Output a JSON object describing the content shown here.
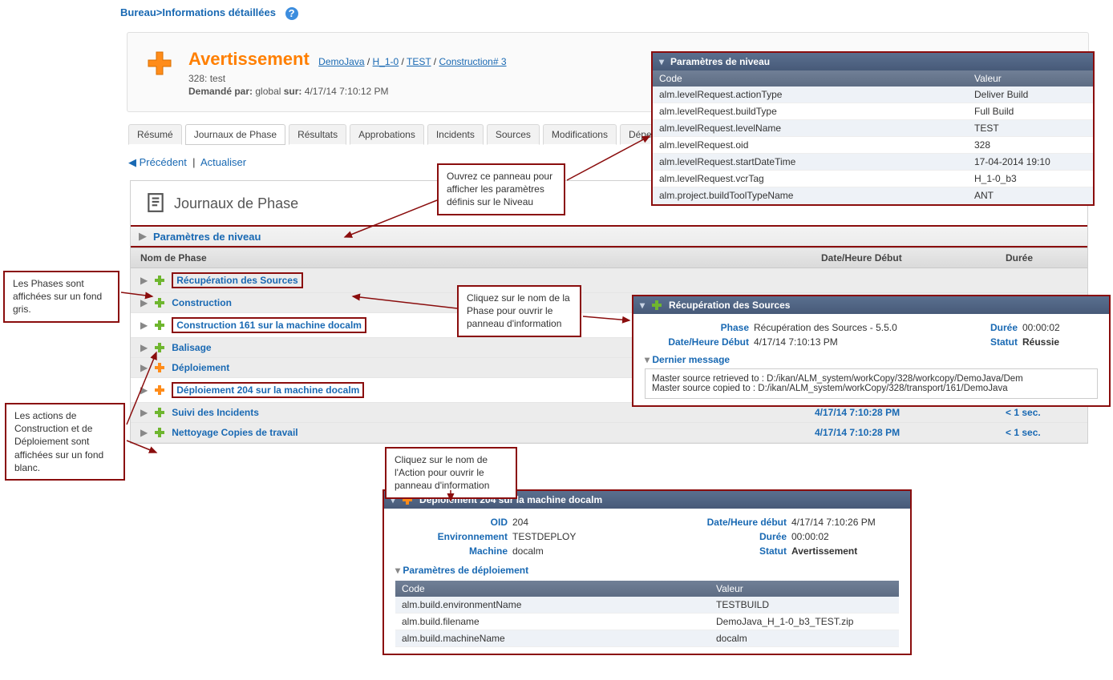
{
  "breadcrumb_top": {
    "seg1": "Bureau",
    "seg2": "Informations détaillées"
  },
  "header": {
    "title": "Avertissement",
    "bc": [
      "DemoJava",
      "H_1-0",
      "TEST",
      "Construction# 3"
    ],
    "line2_label": "328: test",
    "line3_prefix": "Demandé par:",
    "line3_user": "global",
    "line3_sur": "sur:",
    "line3_ts": "4/17/14 7:10:12 PM"
  },
  "tabs": [
    "Résumé",
    "Journaux de Phase",
    "Résultats",
    "Approbations",
    "Incidents",
    "Sources",
    "Modifications",
    "Dépendances"
  ],
  "nav": {
    "prev": "Précédent",
    "refresh": "Actualiser"
  },
  "panel_title": "Journaux de Phase",
  "level_params_link": "Paramètres de niveau",
  "columns": {
    "name": "Nom de Phase",
    "date": "Date/Heure Début",
    "dur": "Durée"
  },
  "phases": [
    {
      "label": "Récupération des Sources",
      "bg": "grey",
      "color": "green"
    },
    {
      "label": "Construction",
      "bg": "grey",
      "color": "green"
    },
    {
      "label": "Construction 161 sur la machine docalm",
      "bg": "white",
      "color": "green"
    },
    {
      "label": "Balisage",
      "bg": "grey",
      "color": "green"
    },
    {
      "label": "Déploiement",
      "bg": "grey",
      "color": "orange"
    },
    {
      "label": "Déploiement 204 sur la machine docalm",
      "bg": "white",
      "color": "orange"
    },
    {
      "label": "Suivi des Incidents",
      "bg": "grey",
      "color": "green",
      "date": "4/17/14 7:10:28 PM",
      "dur": "< 1 sec."
    },
    {
      "label": "Nettoyage Copies de travail",
      "bg": "grey",
      "color": "green",
      "date": "4/17/14 7:10:28 PM",
      "dur": "< 1 sec."
    }
  ],
  "level_panel": {
    "title": "Paramètres de niveau",
    "head_code": "Code",
    "head_val": "Valeur",
    "rows": [
      {
        "c": "alm.levelRequest.actionType",
        "v": "Deliver Build"
      },
      {
        "c": "alm.levelRequest.buildType",
        "v": "Full Build"
      },
      {
        "c": "alm.levelRequest.levelName",
        "v": "TEST"
      },
      {
        "c": "alm.levelRequest.oid",
        "v": "328"
      },
      {
        "c": "alm.levelRequest.startDateTime",
        "v": "17-04-2014 19:10"
      },
      {
        "c": "alm.levelRequest.vcrTag",
        "v": "H_1-0_b3"
      },
      {
        "c": "alm.project.buildToolTypeName",
        "v": "ANT"
      }
    ]
  },
  "callouts": {
    "a": "Ouvrez ce panneau pour afficher les paramètres définis sur le Niveau",
    "b": "Les Phases sont affichées sur un fond gris.",
    "c": "Cliquez sur le nom de la Phase pour ouvrir le panneau d'information",
    "d": "Les actions de Construction et de Déploiement sont affichées sur un fond blanc.",
    "e": "Cliquez sur le nom de l'Action pour ouvrir le panneau d'information"
  },
  "recup_panel": {
    "title": "Récupération des Sources",
    "phase_label": "Phase",
    "phase_val": "Récupération des Sources - 5.5.0",
    "dur_label": "Durée",
    "dur_val": "00:00:02",
    "dt_label": "Date/Heure Début",
    "dt_val": "4/17/14 7:10:13 PM",
    "status_label": "Statut",
    "status_val": "Réussie",
    "last_msg_label": "Dernier message",
    "msg1": "Master source retrieved to : D:/ikan/ALM_system/workCopy/328/workcopy/DemoJava/Dem",
    "msg2": "Master source copied to : D:/ikan/ALM_system/workCopy/328/transport/161/DemoJava"
  },
  "deploy_panel": {
    "title": "Déploiement 204 sur la machine docalm",
    "oid_label": "OID",
    "oid_val": "204",
    "dt_label": "Date/Heure début",
    "dt_val": "4/17/14 7:10:26 PM",
    "env_label": "Environnement",
    "env_val": "TESTDEPLOY",
    "dur_label": "Durée",
    "dur_val": "00:00:02",
    "mach_label": "Machine",
    "mach_val": "docalm",
    "status_label": "Statut",
    "status_val": "Avertissement",
    "params_label": "Paramètres de déploiement",
    "head_code": "Code",
    "head_val": "Valeur",
    "rows": [
      {
        "c": "alm.build.environmentName",
        "v": "TESTBUILD"
      },
      {
        "c": "alm.build.filename",
        "v": "DemoJava_H_1-0_b3_TEST.zip"
      },
      {
        "c": "alm.build.machineName",
        "v": "docalm"
      }
    ]
  }
}
